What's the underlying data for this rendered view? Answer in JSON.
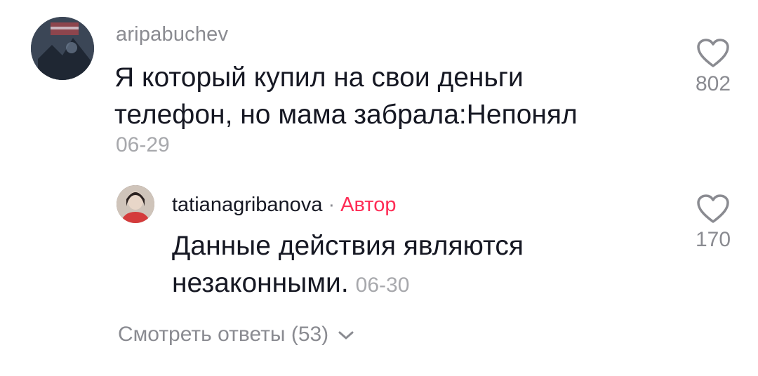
{
  "comments": [
    {
      "username": "aripabuchev",
      "text": "Я который купил на свои деньги телефон, но мама забрала:Непонял",
      "date": "06-29",
      "likes": "802",
      "avatar_icon": "user-avatar"
    }
  ],
  "reply": {
    "username": "tatianagribanova",
    "separator": "·",
    "badge": "Автор",
    "text": "Данные действия являются незаконными.",
    "date": "06-30",
    "likes": "170",
    "avatar_icon": "user-avatar"
  },
  "view_replies_label": "Смотреть ответы (53)",
  "colors": {
    "author_badge": "#fe2c55",
    "secondary_text": "#8a8b91",
    "primary_text": "#161823"
  },
  "icons": {
    "like": "heart-outline-icon",
    "expand": "chevron-down-icon"
  }
}
